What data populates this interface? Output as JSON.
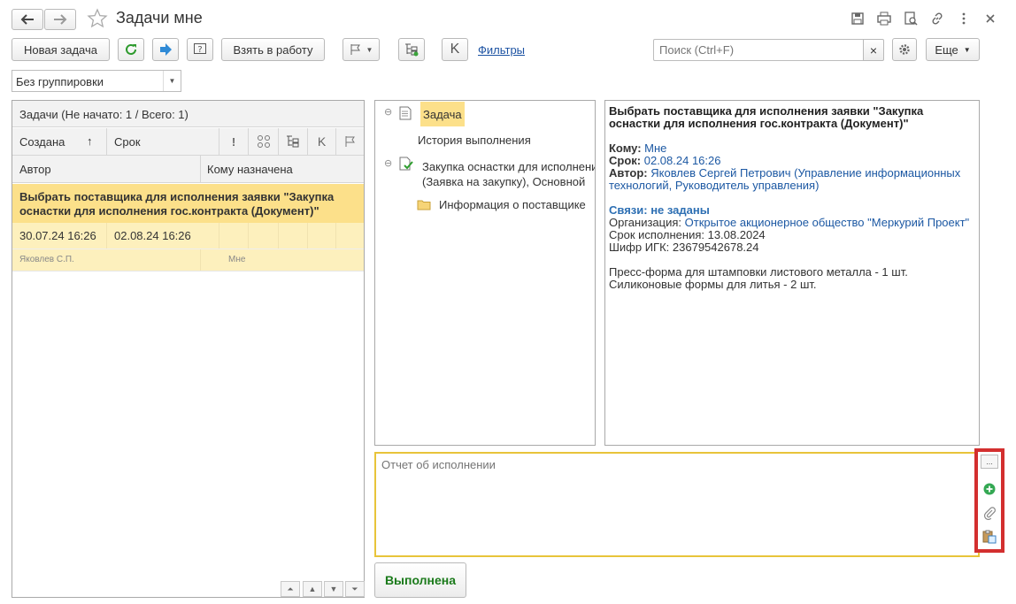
{
  "window": {
    "title": "Задачи мне"
  },
  "toolbar": {
    "new_task": "Новая задача",
    "take_to_work": "Взять в работу",
    "filters": "Фильтры",
    "search_placeholder": "Поиск (Ctrl+F)",
    "search_clear": "×",
    "more": "Еще",
    "k_letter": "K"
  },
  "grouping": {
    "value": "Без группировки"
  },
  "task_list": {
    "header": "Задачи (Не начато: 1 / Всего: 1)",
    "col_created": "Создана",
    "col_deadline": "Срок",
    "col_author": "Автор",
    "col_assignee": "Кому назначена",
    "col_k": "K",
    "rows": [
      {
        "title": "Выбрать поставщика для исполнения заявки \"Закупка оснастки для исполнения гос.контракта (Документ)\"",
        "created": "30.07.24 16:26",
        "deadline": "02.08.24 16:26",
        "author": "Яковлев С.П.",
        "assignee": "Мне"
      }
    ]
  },
  "tree": {
    "task_label": "Задача",
    "history_label": "История выполнения",
    "doc_label_1": "Закупка оснастки для исполнения",
    "doc_label_2": "(Заявка на закупку), Основной",
    "supplier_info": "Информация о поставщике"
  },
  "details": {
    "title": "Выбрать поставщика для исполнения заявки \"Закупка оснастки для исполнения гос.контракта (Документ)\"",
    "to_label": "Кому:",
    "to_value": "Мне",
    "deadline_label": "Срок:",
    "deadline_value": "02.08.24 16:26",
    "author_label": "Автор:",
    "author_value_1": "Яковлев Сергей Петрович (Управление информационных",
    "author_value_2": "технологий, Руководитель управления)",
    "links_label": "Связи: не заданы",
    "org_label": "Организация:",
    "org_value": "Открытое акционерное общество \"Меркурий Проект\"",
    "exec_term": "Срок исполнения: 13.08.2024",
    "igk": "Шифр ИГК: 23679542678.24",
    "line1": "Пресс-форма для штамповки листового металла - 1 шт.",
    "line2": "Силиконовые формы для литья - 2 шт."
  },
  "report": {
    "placeholder": "Отчет об исполнении",
    "more_btn": "..."
  },
  "complete_button": "Выполнена",
  "colors": {
    "selected_row": "#fce08a",
    "selected_row_light": "#fdf3c8",
    "highlight_border": "#d32f2f",
    "report_border": "#e8c43a",
    "link_blue": "#1c52a2",
    "complete_green": "#1a7a1a"
  }
}
